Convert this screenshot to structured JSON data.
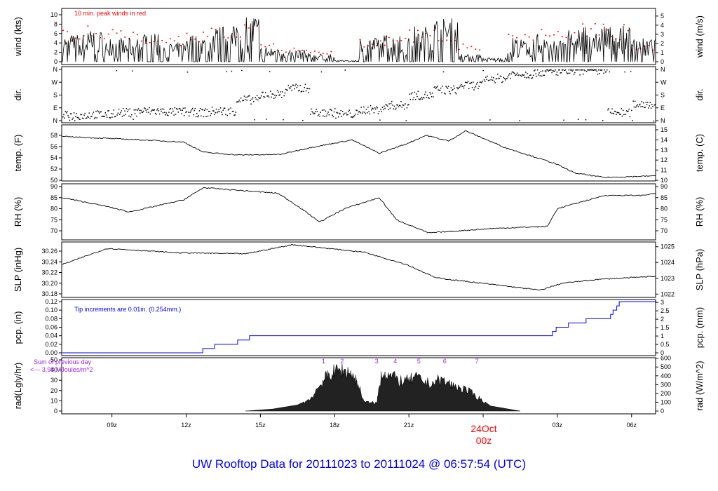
{
  "title": "UW Rooftop Data for 20111023  to  20111024 @ 06:57:54  (UTC)",
  "colors": {
    "line": "#000000",
    "peak": "#ff0000",
    "pcp": "#0000ff",
    "annotation": "#a020f0",
    "title": "#0000ff",
    "date": "#ff0000"
  },
  "chart_data": {
    "type": "line",
    "x_axis": {
      "unit": "hours since 07:00 UTC 23 Oct",
      "range": [
        -0.03,
        23.97
      ],
      "ticks": [
        {
          "t": 2,
          "label": "09z"
        },
        {
          "t": 5,
          "label": "12z"
        },
        {
          "t": 8,
          "label": "15z"
        },
        {
          "t": 11,
          "label": "18z"
        },
        {
          "t": 14,
          "label": "21z"
        },
        {
          "t": 17,
          "label": ""
        },
        {
          "t": 20,
          "label": "03z"
        },
        {
          "t": 23,
          "label": "06z"
        }
      ],
      "date_label": "24Oct",
      "date_hour": "00z"
    },
    "panels": [
      {
        "id": "wind",
        "ylabel": "wind (kts)",
        "ylabel_right": "wind (m/s)",
        "ylim": [
          0,
          10
        ],
        "ticks": [
          0,
          2,
          4,
          6,
          8,
          10
        ],
        "ticks_right": [
          0,
          1,
          2,
          3,
          4,
          5
        ],
        "annotation": "10 min. peak winds in red",
        "hourly_mean": [
          3.5,
          4,
          3,
          3.5,
          2.5,
          3.5,
          4.5,
          6,
          2,
          1.5,
          1,
          0.2,
          3,
          3.5,
          4.5,
          5.5,
          1,
          0.5,
          3,
          3.5,
          4,
          5,
          4.5,
          3
        ],
        "hourly_peak": [
          7,
          8,
          7,
          6.5,
          5.5,
          6.5,
          7.5,
          8.5,
          4,
          3,
          2.5,
          1,
          5,
          6,
          7,
          7.5,
          4,
          3,
          6,
          7,
          7,
          8.5,
          8,
          4
        ]
      },
      {
        "id": "dir",
        "ylabel": "dir.",
        "ylabel_right": "dir.",
        "ylim": [
          0,
          360
        ],
        "ticks": [
          {
            "v": 0,
            "l": "N"
          },
          {
            "v": 90,
            "l": "E"
          },
          {
            "v": 180,
            "l": "S"
          },
          {
            "v": 270,
            "l": "W"
          },
          {
            "v": 360,
            "l": "N"
          }
        ],
        "hourly_dir": [
          40,
          45,
          60,
          70,
          65,
          60,
          70,
          150,
          190,
          230,
          60,
          50,
          80,
          110,
          180,
          220,
          250,
          300,
          330,
          345,
          350,
          355,
          60,
          120
        ]
      },
      {
        "id": "temp",
        "ylabel": "temp. (F)",
        "ylabel_right": "temp. (C)",
        "ylim": [
          50,
          58
        ],
        "ticks": [
          50,
          52,
          54,
          56,
          58
        ],
        "ticks_right": [
          10,
          11,
          12,
          13,
          14,
          15
        ],
        "points": [
          [
            0,
            57.8
          ],
          [
            3.2,
            57.2
          ],
          [
            4.9,
            56.8
          ],
          [
            5.7,
            55
          ],
          [
            7.1,
            54.5
          ],
          [
            8.8,
            54.6
          ],
          [
            10,
            55.8
          ],
          [
            11.7,
            57.2
          ],
          [
            12.8,
            54.8
          ],
          [
            13.9,
            56.5
          ],
          [
            14.7,
            58
          ],
          [
            15.6,
            57
          ],
          [
            16.3,
            58.8
          ],
          [
            17.9,
            55.8
          ],
          [
            19.9,
            53
          ],
          [
            20.7,
            51.3
          ],
          [
            21.9,
            50.5
          ],
          [
            24,
            50.8
          ]
        ]
      },
      {
        "id": "rh",
        "ylabel": "RH (%)",
        "ylabel_right": "RH (%)",
        "ylim": [
          70,
          90
        ],
        "ticks": [
          70,
          75,
          80,
          85,
          90
        ],
        "ticks_right": [
          70,
          75,
          80,
          85,
          90
        ],
        "points": [
          [
            0,
            85
          ],
          [
            1.8,
            81
          ],
          [
            2.7,
            78.5
          ],
          [
            4.9,
            84
          ],
          [
            5.7,
            89.5
          ],
          [
            8.7,
            87
          ],
          [
            9.4,
            82
          ],
          [
            10.4,
            74
          ],
          [
            11.4,
            80
          ],
          [
            12.8,
            85
          ],
          [
            13.5,
            75
          ],
          [
            14.8,
            69
          ],
          [
            17.3,
            71
          ],
          [
            19.6,
            72
          ],
          [
            20,
            80
          ],
          [
            21.9,
            86
          ],
          [
            23.4,
            86
          ],
          [
            24,
            87
          ]
        ]
      },
      {
        "id": "slp",
        "ylabel": "SLP (inHg)",
        "ylabel_right": "SLP (hPa)",
        "ylim": [
          30.18,
          30.26
        ],
        "ticks": [
          30.18,
          30.2,
          30.22,
          30.24,
          30.26
        ],
        "ticks_right": [
          1022,
          1023,
          1024,
          1025
        ],
        "points": [
          [
            0,
            30.235
          ],
          [
            1.8,
            30.265
          ],
          [
            4.6,
            30.257
          ],
          [
            7.4,
            30.255
          ],
          [
            9.3,
            30.272
          ],
          [
            12.2,
            30.258
          ],
          [
            13.9,
            30.235
          ],
          [
            15.1,
            30.21
          ],
          [
            17.3,
            30.198
          ],
          [
            19.3,
            30.187
          ],
          [
            20.2,
            30.2
          ],
          [
            21.6,
            30.207
          ],
          [
            24,
            30.213
          ]
        ]
      },
      {
        "id": "pcp",
        "ylabel": "pcp. (in)",
        "ylabel_right": "pcp. (mm)",
        "ylim": [
          0,
          0.12
        ],
        "ticks": [
          0,
          0.02,
          0.04,
          0.06,
          0.08,
          0.1,
          0.12
        ],
        "ticks_right": [
          0,
          0.5,
          1,
          1.5,
          2,
          2.5,
          3
        ],
        "annotation": "Tip increments are 0.01in. (0.254mm.)",
        "steps": [
          [
            0,
            0
          ],
          [
            5.67,
            0.01
          ],
          [
            6.15,
            0.02
          ],
          [
            7.08,
            0.03
          ],
          [
            7.56,
            0.04
          ],
          [
            19.8,
            0.05
          ],
          [
            19.95,
            0.06
          ],
          [
            20.45,
            0.07
          ],
          [
            21.16,
            0.08
          ],
          [
            22.15,
            0.09
          ],
          [
            22.25,
            0.1
          ],
          [
            22.4,
            0.11
          ],
          [
            22.5,
            0.12
          ],
          [
            24,
            0.12
          ]
        ]
      },
      {
        "id": "rad",
        "ylabel": "rad(Lgly/hr)",
        "ylabel_right": "rad (W/m^2)",
        "ylim": [
          0,
          50
        ],
        "ticks": [
          0,
          10,
          20,
          30,
          40,
          50
        ],
        "ticks_right": [
          0,
          100,
          200,
          300,
          400,
          500,
          600
        ],
        "annotation_1": "Sum of previous day",
        "annotation_2": "<--- 3.98 MJoules/m^2",
        "markers": [
          {
            "t": 10.55,
            "l": "1"
          },
          {
            "t": 11.3,
            "l": "2"
          },
          {
            "t": 12.7,
            "l": "3"
          },
          {
            "t": 13.45,
            "l": "4"
          },
          {
            "t": 14.4,
            "l": "5"
          },
          {
            "t": 15.45,
            "l": "6"
          },
          {
            "t": 16.75,
            "l": "7"
          }
        ],
        "points": [
          [
            7.4,
            0
          ],
          [
            8.5,
            2
          ],
          [
            9.5,
            6
          ],
          [
            10,
            12
          ],
          [
            10.5,
            30
          ],
          [
            10.8,
            38
          ],
          [
            11.2,
            42
          ],
          [
            11.6,
            40
          ],
          [
            11.9,
            30
          ],
          [
            12.2,
            9
          ],
          [
            12.7,
            8
          ],
          [
            12.9,
            40
          ],
          [
            13.3,
            35
          ],
          [
            13.8,
            30
          ],
          [
            14.3,
            34
          ],
          [
            14.8,
            28
          ],
          [
            15.3,
            32
          ],
          [
            15.8,
            26
          ],
          [
            16.3,
            22
          ],
          [
            16.8,
            14
          ],
          [
            17.3,
            5
          ],
          [
            18.5,
            0
          ]
        ]
      }
    ]
  }
}
